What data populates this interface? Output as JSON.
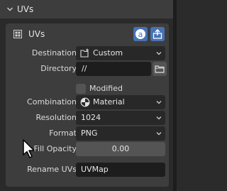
{
  "header": {
    "title": "UVs"
  },
  "panel": {
    "title": "UVs",
    "rows": {
      "destination": {
        "label": "Destination",
        "value": "Custom"
      },
      "directory": {
        "label": "Directory",
        "value": "//"
      },
      "modified": {
        "label": "Modified",
        "checked": false
      },
      "combination": {
        "label": "Combination",
        "value": "Material"
      },
      "resolution": {
        "label": "Resolution",
        "value": "1024"
      },
      "format": {
        "label": "Format",
        "value": "PNG"
      },
      "fill_opacity": {
        "label": "Fill Opacity",
        "value": "0.00"
      },
      "rename": {
        "label": "Rename UVs",
        "value": "UVMap"
      }
    }
  },
  "icons": {
    "header_chevron": "chevron-down-icon",
    "drag_handle": "grip-icon",
    "text_icon": "font-icon",
    "export_icon": "export-icon",
    "destination_icon": "folder-new-icon",
    "folder_icon": "folder-icon",
    "material_icon": "material-sphere-icon"
  },
  "colors": {
    "accent": "#4772b3",
    "panel_bg": "#3d3d3d",
    "field_bg": "#282828"
  }
}
